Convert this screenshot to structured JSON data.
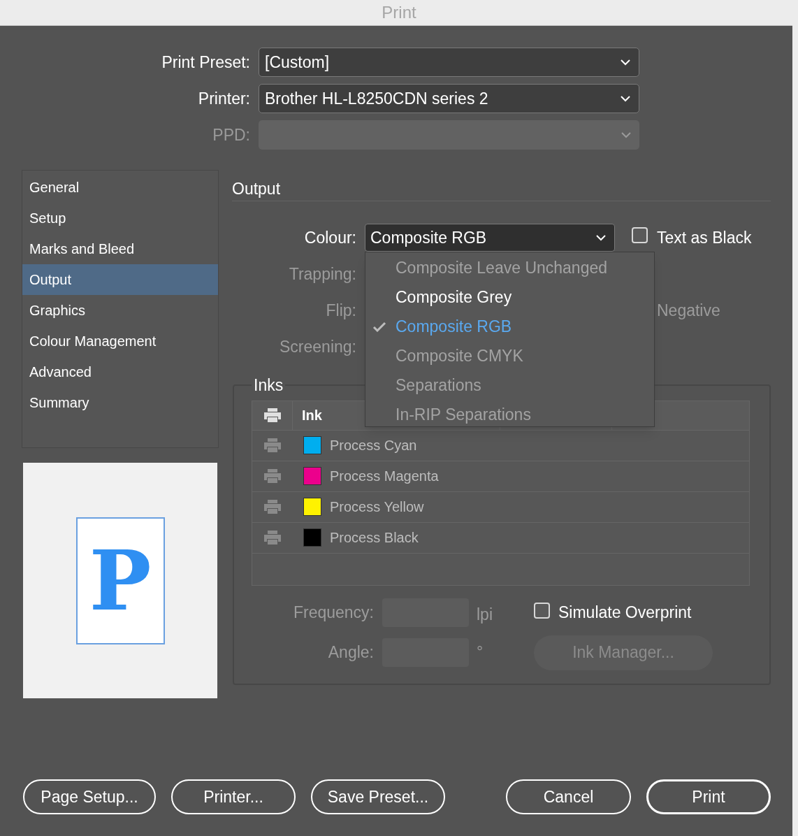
{
  "window": {
    "title": "Print"
  },
  "top_fields": [
    {
      "label": "Print Preset:",
      "value": "[Custom]",
      "disabled": false
    },
    {
      "label": "Printer:",
      "value": "Brother HL-L8250CDN series 2",
      "disabled": false
    },
    {
      "label": "PPD:",
      "disabled": true
    }
  ],
  "sidebar": {
    "items": [
      {
        "label": "General",
        "selected": false
      },
      {
        "label": "Setup",
        "selected": false
      },
      {
        "label": "Marks and Bleed",
        "selected": false
      },
      {
        "label": "Output",
        "selected": true
      },
      {
        "label": "Graphics",
        "selected": false
      },
      {
        "label": "Colour Management",
        "selected": false
      },
      {
        "label": "Advanced",
        "selected": false
      },
      {
        "label": "Summary",
        "selected": false
      }
    ]
  },
  "preview": {
    "letter": "P"
  },
  "section": {
    "title": "Output"
  },
  "colour": {
    "label": "Colour:",
    "value": "Composite RGB"
  },
  "text_as_black": {
    "label": "Text as Black",
    "checked": false
  },
  "disabled_labels": [
    "Trapping:",
    "Flip:",
    "Screening:"
  ],
  "negative_label": "Negative",
  "colour_menu": [
    {
      "label": "Composite Leave Unchanged",
      "selected": false,
      "disabled": true
    },
    {
      "label": "Composite Grey",
      "selected": false,
      "disabled": false
    },
    {
      "label": "Composite RGB",
      "selected": true,
      "disabled": false
    },
    {
      "label": "Composite CMYK",
      "selected": false,
      "disabled": true
    },
    {
      "label": "Separations",
      "selected": false,
      "disabled": true
    },
    {
      "label": "In-RIP Separations",
      "selected": false,
      "disabled": true
    }
  ],
  "inks": {
    "title": "Inks",
    "header": "Ink",
    "rows": [
      {
        "name": "Process Cyan",
        "color": "#00aeef"
      },
      {
        "name": "Process Magenta",
        "color": "#ec008c"
      },
      {
        "name": "Process Yellow",
        "color": "#fff200"
      },
      {
        "name": "Process Black",
        "color": "#000000"
      }
    ]
  },
  "frequency": {
    "label": "Frequency:",
    "unit": "lpi"
  },
  "angle": {
    "label": "Angle:",
    "unit": "°"
  },
  "simulate_overprint": {
    "label": "Simulate Overprint",
    "checked": false
  },
  "ink_manager": {
    "label": "Ink Manager...",
    "disabled": true
  },
  "buttons": [
    {
      "label": "Page Setup...",
      "kind": "normal"
    },
    {
      "label": "Printer...",
      "kind": "normal"
    },
    {
      "label": "Save Preset...",
      "kind": "normal"
    },
    {
      "label": "Cancel",
      "kind": "normal"
    },
    {
      "label": "Print",
      "kind": "default"
    }
  ]
}
